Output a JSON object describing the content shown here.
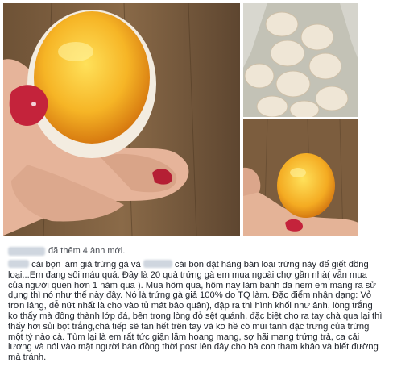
{
  "post": {
    "added_photos_text": "đã thêm 4 ảnh mới.",
    "body_part1": " cái bọn làm giả trứng gà và ",
    "body_part2": " cái bọn đặt hàng bán loại trứng này để giết đồng loại...Em đang sôi máu quá. Đây là 20 quả trứng gà em mua ngoài chợ gần nhà( vẫn mua của người quen hơn 1 năm qua ). Mua hôm qua, hôm nay làm bánh đa nem em mang ra sử dụng thì nó như thế này đây. Nó là trứng gà giả 100% do TQ làm. Đặc điểm nhận dạng: Vỏ trơn láng, dễ nứt nhất là cho vào tủ mát bảo quản), đập ra thì hình khối như ảnh, lòng trắng ko thấy mà đông thành lớp đá, bên trong lòng đỏ sệt quánh, đặc biệt cho ra tay chà qua lại thì thấy hơi sủi bọt trắng,chà tiếp sẽ tan hết trên tay và ko hề có mùi tanh đặc trưng của trứng một tý nào cả. Tùm lại là em rất tức giận lắm hoang mang, sợ hãi mang trứng trả, ca cải lương và nói vào mặt người bán đồng thời post lên đây cho bà con tham khảo và biết đường mà tránh."
  },
  "photos": [
    {
      "subject": "hand-holding-cracked-egg-yolk"
    },
    {
      "subject": "bag-of-eggs"
    },
    {
      "subject": "hand-holding-yolk"
    }
  ],
  "colors": {
    "yolk": "#f2a21c",
    "yolk_light": "#ffd23c",
    "wood": "#7a5a3a",
    "nail": "#c4233b"
  }
}
